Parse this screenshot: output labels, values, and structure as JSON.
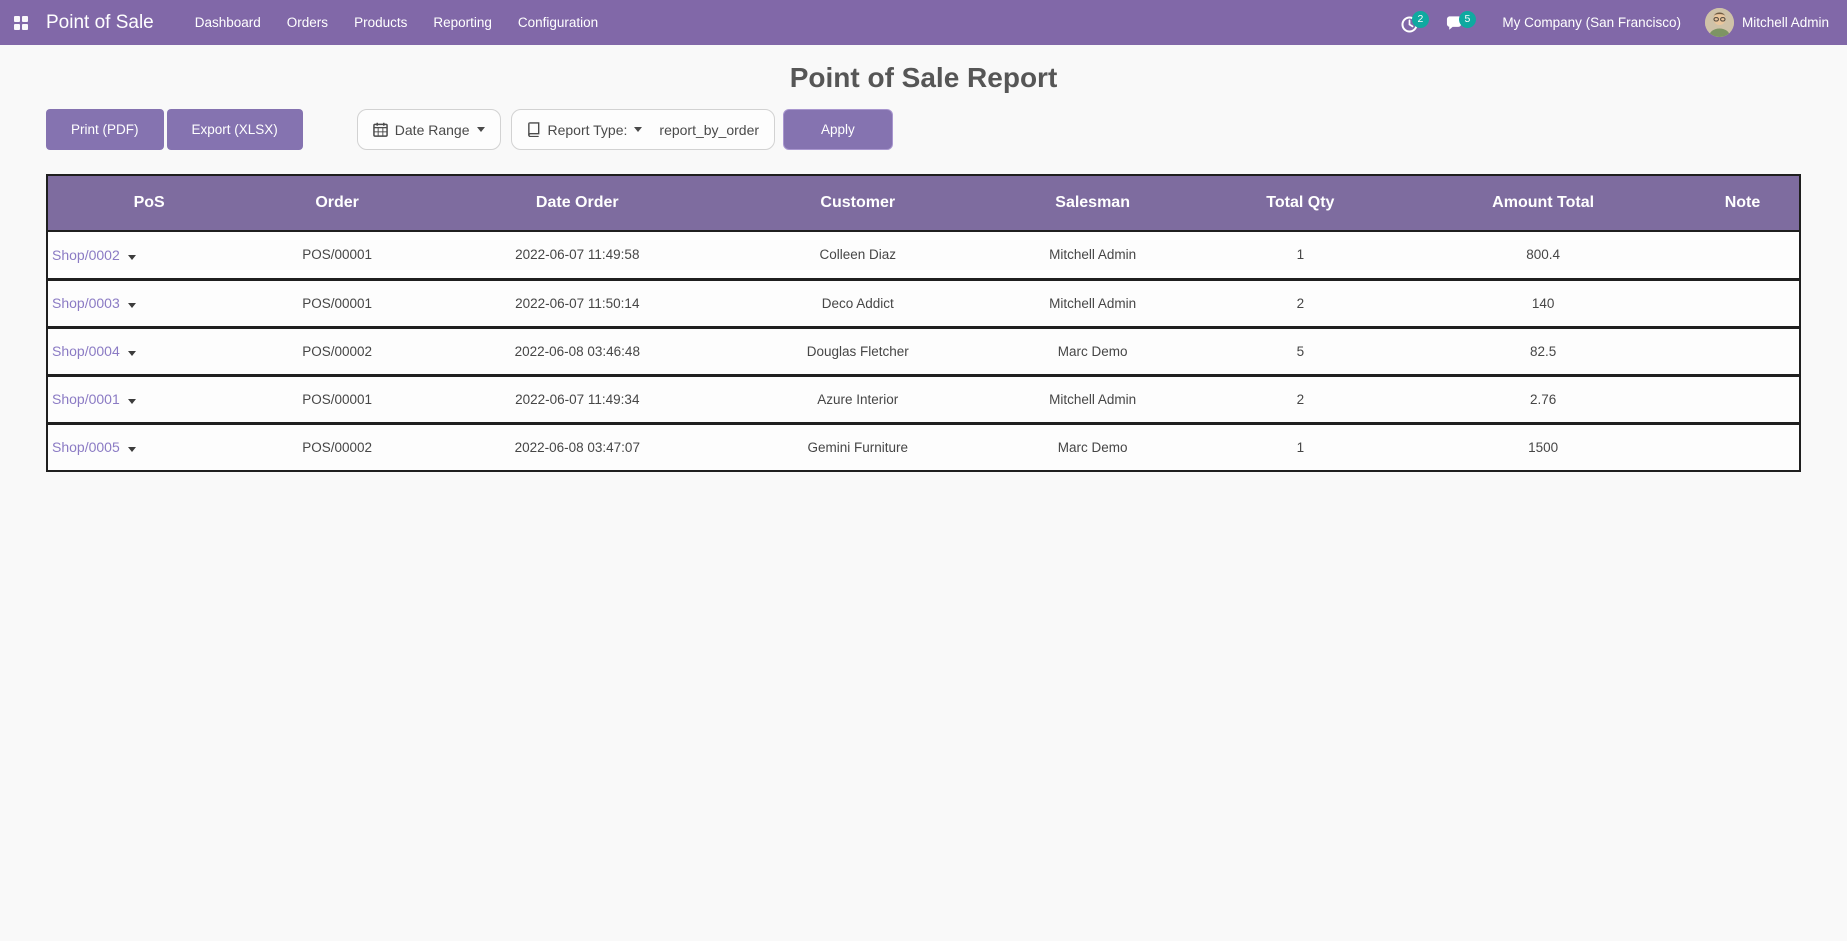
{
  "navbar": {
    "brand": "Point of Sale",
    "items": [
      "Dashboard",
      "Orders",
      "Products",
      "Reporting",
      "Configuration"
    ],
    "activity_badge": "2",
    "message_badge": "5",
    "company": "My Company (San Francisco)",
    "user": "Mitchell Admin"
  },
  "page": {
    "title": "Point of Sale Report"
  },
  "toolbar": {
    "print_label": "Print (PDF)",
    "export_label": "Export (XLSX)",
    "date_range_label": "Date Range",
    "report_type_label": "Report Type:",
    "report_type_value": "report_by_order",
    "apply_label": "Apply"
  },
  "table": {
    "headers": [
      "PoS",
      "Order",
      "Date Order",
      "Customer",
      "Salesman",
      "Total Qty",
      "Amount Total",
      "Note"
    ],
    "rows": [
      {
        "pos": "Shop/0002",
        "order": "POS/00001",
        "date": "2022-06-07 11:49:58",
        "customer": "Colleen Diaz",
        "salesman": "Mitchell Admin",
        "qty": "1",
        "amount": "800.4",
        "note": ""
      },
      {
        "pos": "Shop/0003",
        "order": "POS/00001",
        "date": "2022-06-07 11:50:14",
        "customer": "Deco Addict",
        "salesman": "Mitchell Admin",
        "qty": "2",
        "amount": "140",
        "note": ""
      },
      {
        "pos": "Shop/0004",
        "order": "POS/00002",
        "date": "2022-06-08 03:46:48",
        "customer": "Douglas Fletcher",
        "salesman": "Marc Demo",
        "qty": "5",
        "amount": "82.5",
        "note": ""
      },
      {
        "pos": "Shop/0001",
        "order": "POS/00001",
        "date": "2022-06-07 11:49:34",
        "customer": "Azure Interior",
        "salesman": "Mitchell Admin",
        "qty": "2",
        "amount": "2.76",
        "note": ""
      },
      {
        "pos": "Shop/0005",
        "order": "POS/00002",
        "date": "2022-06-08 03:47:07",
        "customer": "Gemini Furniture",
        "salesman": "Marc Demo",
        "qty": "1",
        "amount": "1500",
        "note": ""
      }
    ]
  },
  "icons": {
    "apps": "grid-2x2",
    "activity": "clock",
    "messages": "chat-bubble",
    "date_range": "calendar",
    "report_type": "book",
    "dropdowns": "caret-down"
  },
  "colors": {
    "navbar-bg": "#8168a8",
    "header-bg": "#7e6c9f",
    "button-bg": "#8573b0",
    "badge-bg": "#0fa9a0",
    "link-color": "#8b7bc4",
    "page-bg": "#f9f9f9",
    "border-dark": "#1f1f1f",
    "text-dark": "#4a4a4a"
  }
}
